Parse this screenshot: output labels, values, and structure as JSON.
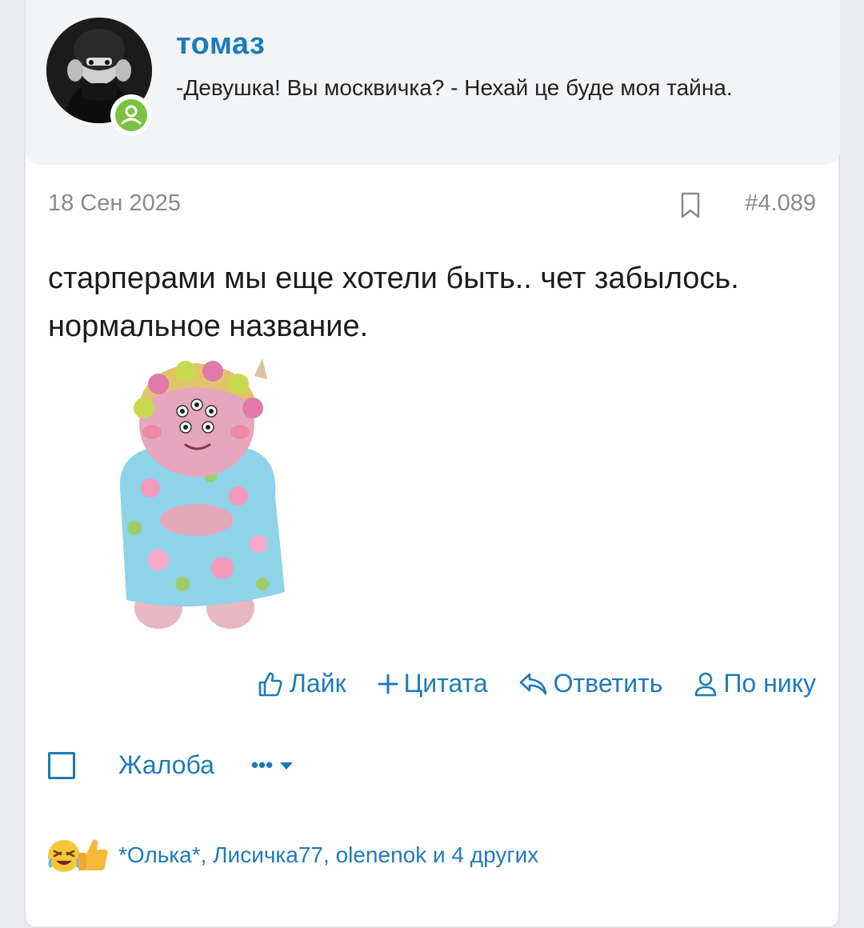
{
  "author": {
    "username": "томаз",
    "status": "-Девушка! Вы москвичка? - Нехай це буде моя тайна.",
    "online": true
  },
  "post": {
    "date": "18 Сен 2025",
    "number": "#4.089",
    "text": "старперами мы еще хотели быть.. чет забылось. нормальное название."
  },
  "actions": {
    "like": "Лайк",
    "quote": "Цитата",
    "reply": "Ответить",
    "by_nick": "По нику"
  },
  "moderation": {
    "report": "Жалоба",
    "more": "•••"
  },
  "reactions": {
    "icons": [
      "rofl-emoji-icon",
      "thumbs-up-icon"
    ],
    "text": "*Олька*, Лисичка77, olenenok и 4 других"
  },
  "colors": {
    "accent": "#1e7bb8",
    "header_bg": "#f3f4f6",
    "online": "#7cc242",
    "meta": "#8a8a8a"
  }
}
